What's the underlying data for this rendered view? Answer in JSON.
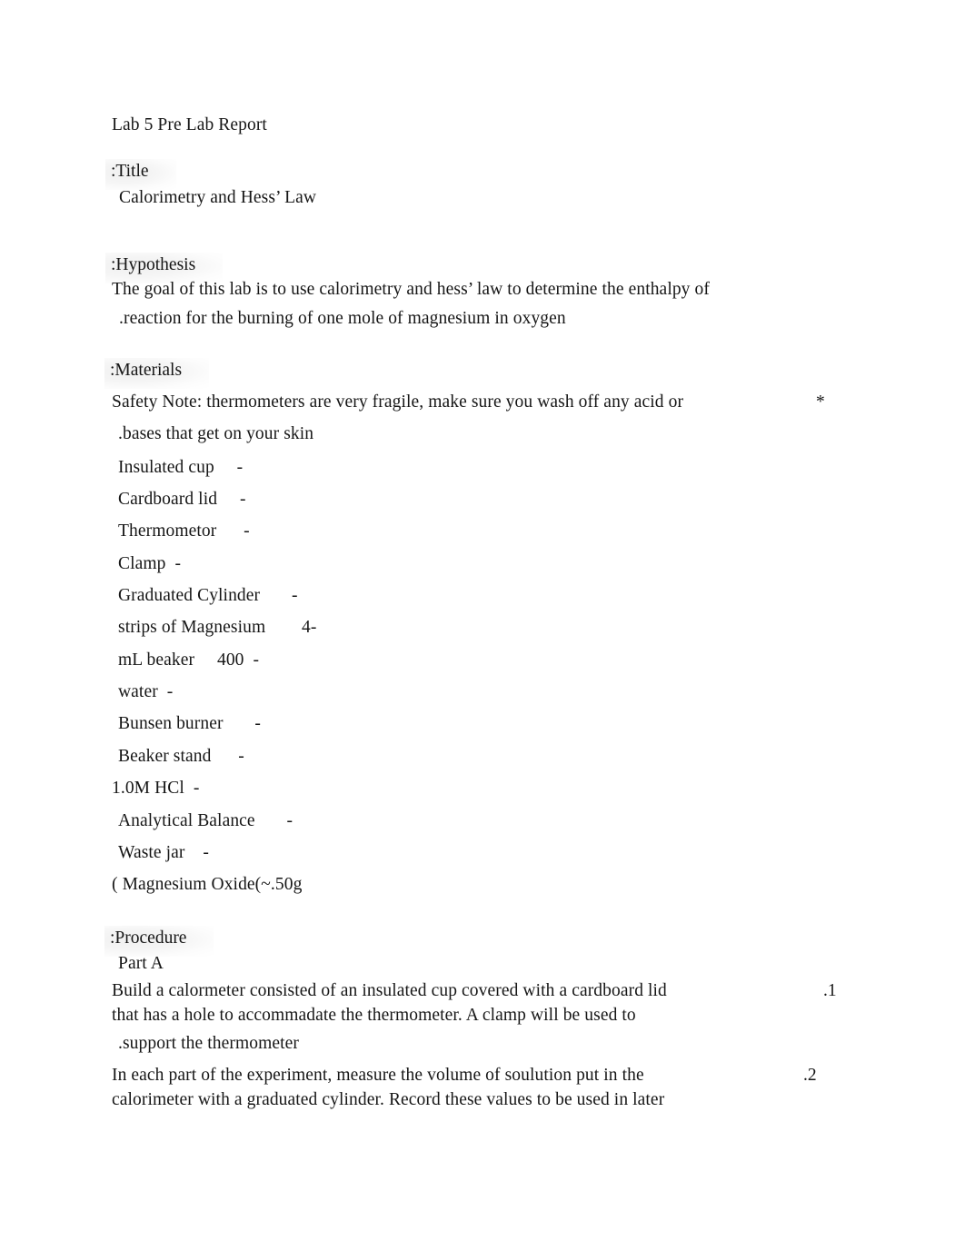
{
  "document": {
    "title_line": "Lab 5 Pre Lab Report",
    "sections": {
      "title": {
        "heading": ":Title",
        "value": "Calorimetry and Hess’ Law"
      },
      "hypothesis": {
        "heading": ":Hypothesis",
        "line1": "The goal of this lab is to use calorimetry and hess’ law to determine the enthalpy of",
        "line2": ".reaction for the burning of one mole of magnesium in oxygen"
      },
      "materials": {
        "heading": ":Materials",
        "safety_note_line1": "Safety Note: thermometers are very fragile, make sure you wash off any acid or",
        "safety_note_line2": ".bases that get on your skin",
        "safety_note_bullet": "*",
        "items": [
          "Insulated cup     -",
          "Cardboard lid     -",
          "Thermometor      -",
          "Clamp  -",
          "Graduated Cylinder       -",
          "strips of Magnesium        4-",
          "mL beaker     400  -",
          "water  -",
          "Bunsen burner       -",
          "Beaker stand      -",
          "1.0M HCl  -",
          "Analytical Balance       -",
          "Waste jar    -",
          "( Magnesium Oxide(~.50g"
        ]
      },
      "procedure": {
        "heading": ":Procedure",
        "part_label": "Part A",
        "steps": [
          {
            "number": ".1",
            "line1": "Build a calormeter consisted of an insulated cup covered with a cardboard lid",
            "line2": "that has a hole to accommadate the thermometer. A clamp will be used to",
            "line3": ".support the thermometer"
          },
          {
            "number": ".2",
            "line1": "In each part of the experiment, measure the volume of soulution put in the",
            "line2": "calorimeter with a graduated cylinder. Record these values to be used in later"
          }
        ]
      }
    }
  }
}
